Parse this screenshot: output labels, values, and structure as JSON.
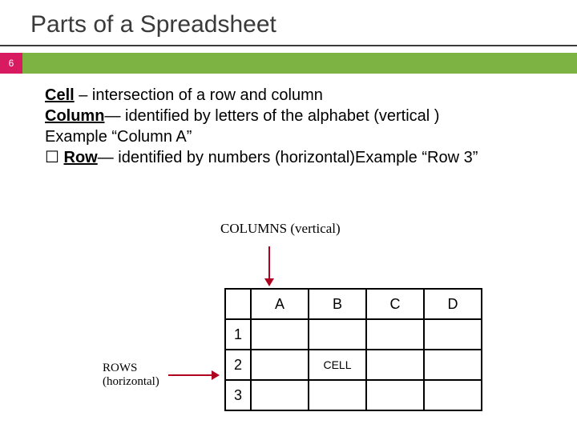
{
  "title": "Parts of a Spreadsheet",
  "page_number": "6",
  "definitions": {
    "cell_term": "Cell",
    "cell_rest": " – intersection of a row and column",
    "column_term": "Column",
    "column_rest": "— identified by letters of the alphabet (vertical )",
    "column_example": "Example “Column A”",
    "row_checkbox": "☐ ",
    "row_term": "Row",
    "row_rest": "— identified by numbers (horizontal)Example “Row 3”"
  },
  "diagram": {
    "columns_label": "COLUMNS  (vertical)",
    "rows_label_1": "ROWS",
    "rows_label_2": "(horizontal)",
    "cell_label": "CELL",
    "col_headers": [
      "A",
      "B",
      "C",
      "D"
    ],
    "row_headers": [
      "1",
      "2",
      "3"
    ]
  },
  "chart_data": {
    "type": "table",
    "title": "Spreadsheet grid illustration",
    "columns": [
      "A",
      "B",
      "C",
      "D"
    ],
    "rows": [
      "1",
      "2",
      "3"
    ],
    "annotations": {
      "B2": "CELL"
    }
  }
}
